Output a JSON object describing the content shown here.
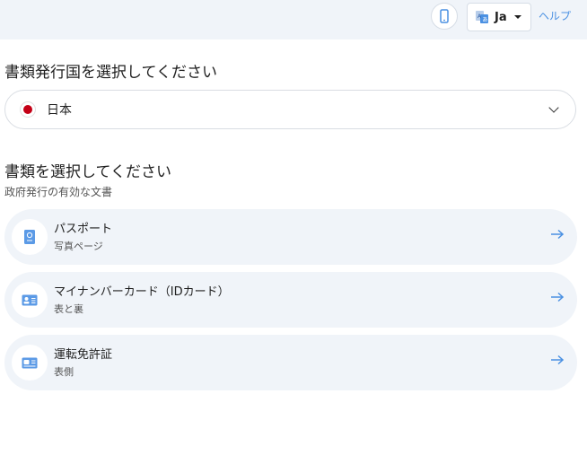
{
  "header": {
    "device_icon": "mobile-phone-icon",
    "language": {
      "icon": "translate-icon",
      "label": "Ja"
    },
    "help_label": "ヘルプ"
  },
  "country_section": {
    "title": "書類発行国を選択してください",
    "selected_country": "日本",
    "flag": "japan-flag-icon"
  },
  "document_section": {
    "title": "書類を選択してください",
    "subtitle": "政府発行の有効な文書",
    "documents": [
      {
        "title": "パスポート",
        "subtitle": "写真ページ",
        "icon": "passport-icon"
      },
      {
        "title": "マイナンバーカード（IDカード）",
        "subtitle": "表と裏",
        "icon": "id-card-icon"
      },
      {
        "title": "運転免許証",
        "subtitle": "表側",
        "icon": "drivers-license-icon"
      }
    ]
  },
  "colors": {
    "accent": "#4a90e2",
    "card_background": "#f0f4f9",
    "header_background": "#f0f4f9",
    "flag_red": "#c40016"
  }
}
